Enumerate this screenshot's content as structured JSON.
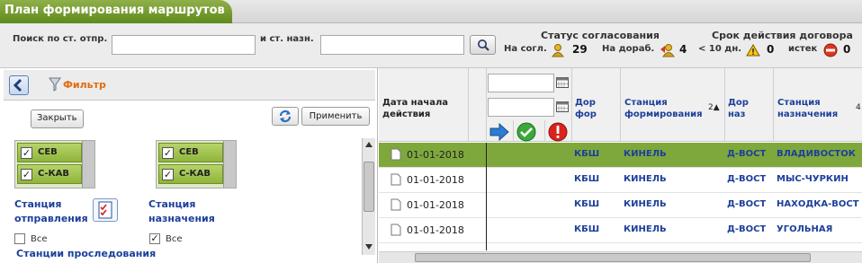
{
  "app": {
    "title": "План формирования маршрутов"
  },
  "search": {
    "from_label": "Поиск по ст. отпр.",
    "from_value": "",
    "to_label": "и ст. назн.",
    "to_value": ""
  },
  "status": {
    "approval_title": "Статус согласования",
    "on_approval_label": "На согл.",
    "on_approval_count": "29",
    "on_rework_label": "На дораб.",
    "on_rework_count": "4",
    "contract_title": "Срок действия договора",
    "less10_label": "< 10 дн.",
    "less10_count": "0",
    "expired_label": "истек",
    "expired_count": "0"
  },
  "filter": {
    "title": "Фильтр",
    "close_label": "Закрыть",
    "apply_label": "Применить",
    "left_list": [
      {
        "label": "СЕВ",
        "checked": true
      },
      {
        "label": "С-КАВ",
        "checked": true
      }
    ],
    "right_list": [
      {
        "label": "СЕВ",
        "checked": true
      },
      {
        "label": "С-КАВ",
        "checked": true
      }
    ],
    "dep_station_label": "Станция отправления",
    "dep_station_line1": "Станция",
    "dep_station_line2": "отправления",
    "dest_station_line1": "Станция",
    "dest_station_line2": "назначения",
    "all_label": "Все",
    "all_left_checked": false,
    "all_right_checked": true,
    "trace_title": "Станции проследования"
  },
  "grid": {
    "headers": {
      "date_line1": "Дата начала",
      "date_line2": "действия",
      "road_from_line1": "Дор",
      "road_from_line2": "фор",
      "station_from_line1": "Станция",
      "station_from_line2": "формирования",
      "sort_marker": "2▲",
      "road_to_line1": "Дор",
      "road_to_line2": "наз",
      "station_to_line1": "Станция",
      "station_to_line2": "назначения",
      "sort_marker2": "4"
    },
    "rows": [
      {
        "date": "01-01-2018",
        "road_from": "КБШ",
        "station_from": "КИНЕЛЬ",
        "road_to": "Д-ВОСТ",
        "station_to": "ВЛАДИВОСТОК",
        "selected": true
      },
      {
        "date": "01-01-2018",
        "road_from": "КБШ",
        "station_from": "КИНЕЛЬ",
        "road_to": "Д-ВОСТ",
        "station_to": "МЫС-ЧУРКИН",
        "selected": false
      },
      {
        "date": "01-01-2018",
        "road_from": "КБШ",
        "station_from": "КИНЕЛЬ",
        "road_to": "Д-ВОСТ",
        "station_to": "НАХОДКА-ВОСТ",
        "selected": false
      },
      {
        "date": "01-01-2018",
        "road_from": "КБШ",
        "station_from": "КИНЕЛЬ",
        "road_to": "Д-ВОСТ",
        "station_to": "УГОЛЬНАЯ",
        "selected": false
      }
    ]
  },
  "colors": {
    "accent_green": "#6f9a2c",
    "link_blue": "#1c3f9a",
    "filter_orange": "#e06d10"
  }
}
